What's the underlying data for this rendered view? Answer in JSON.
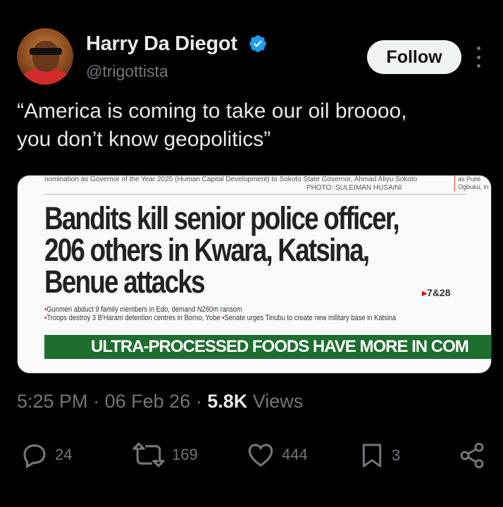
{
  "author": {
    "name": "Harry Da Diegot",
    "handle": "@trigottista",
    "verified": true,
    "avatar": "avatar-photo"
  },
  "follow_label": "Follow",
  "tweet_text": "“America is coming to take our oil broooo,\nyou don’t know geopolitics”",
  "media": {
    "top_caption": "nomination as Governor of the Year 2025 (Human Capital Development) to Sokoto State Governor, Ahmad Aliyu Sokoto",
    "photo_credit": "PHOTO: SULEIMAN HUSAINI",
    "right_snippet": "as Publi Ogbuku, in",
    "headline": "Bandits kill senior police officer, 206 others in Kwara, Katsina, Benue attacks",
    "page_ref": "7&28",
    "bullet1": "Gunmen abduct 9 family members in Edo, demand N260m ransom",
    "bullet2": "Troops destroy 3 B'Haram detention centres in Borno, Yobe",
    "bullet3": "Senate urges Tinubu to create new military base in Katsina",
    "banner": "ULTRA-PROCESSED FOODS HAVE MORE IN COM"
  },
  "meta": {
    "time": "5:25 PM",
    "date": "06 Feb 26",
    "views_count": "5.8K",
    "views_label": "Views"
  },
  "actions": {
    "replies": "24",
    "reposts": "169",
    "likes": "444",
    "bookmarks": "3"
  },
  "colors": {
    "background": "#000000",
    "primary_text": "#e7e9ea",
    "secondary_text": "#71767b",
    "verified_blue": "#1d9bf0",
    "follow_bg": "#eff3f4"
  }
}
